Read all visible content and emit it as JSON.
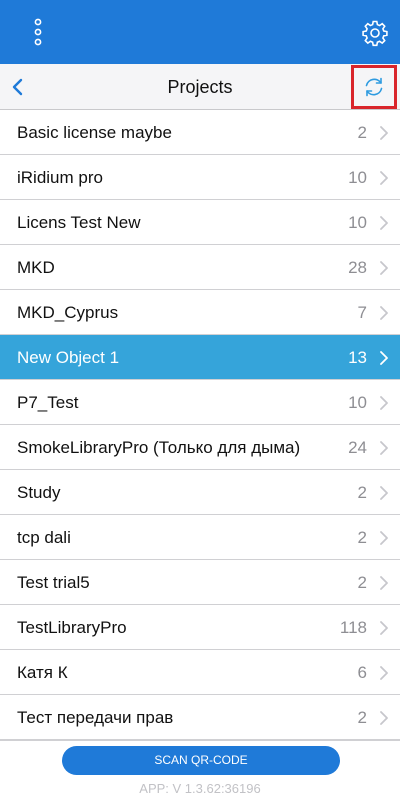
{
  "header": {
    "menu_icon": "more-vertical-icon",
    "settings_icon": "gear-icon"
  },
  "navbar": {
    "back_icon": "chevron-left-icon",
    "title": "Projects",
    "refresh_icon": "refresh-icon",
    "refresh_highlight_color": "#d9252b"
  },
  "projects": [
    {
      "name": "Basic license maybe",
      "count": "2"
    },
    {
      "name": "iRidium pro",
      "count": "10"
    },
    {
      "name": "Licens Test New",
      "count": "10"
    },
    {
      "name": "MKD",
      "count": "28"
    },
    {
      "name": "MKD_Cyprus",
      "count": "7"
    },
    {
      "name": "New Object 1",
      "count": "13",
      "selected": true
    },
    {
      "name": "P7_Test",
      "count": "10"
    },
    {
      "name": "SmokeLibraryPro (Только для дыма)",
      "count": "24"
    },
    {
      "name": "Study",
      "count": "2"
    },
    {
      "name": "tcp dali",
      "count": "2"
    },
    {
      "name": "Test trial5",
      "count": "2"
    },
    {
      "name": "TestLibraryPro",
      "count": "118"
    },
    {
      "name": "Катя К",
      "count": "6"
    },
    {
      "name": "Тест передачи прав",
      "count": "2"
    }
  ],
  "footer": {
    "scan_label": "SCAN QR-CODE",
    "version": "APP: V 1.3.62:36196"
  },
  "colors": {
    "primary": "#1f7ad8",
    "selected_row": "#35a4da"
  }
}
